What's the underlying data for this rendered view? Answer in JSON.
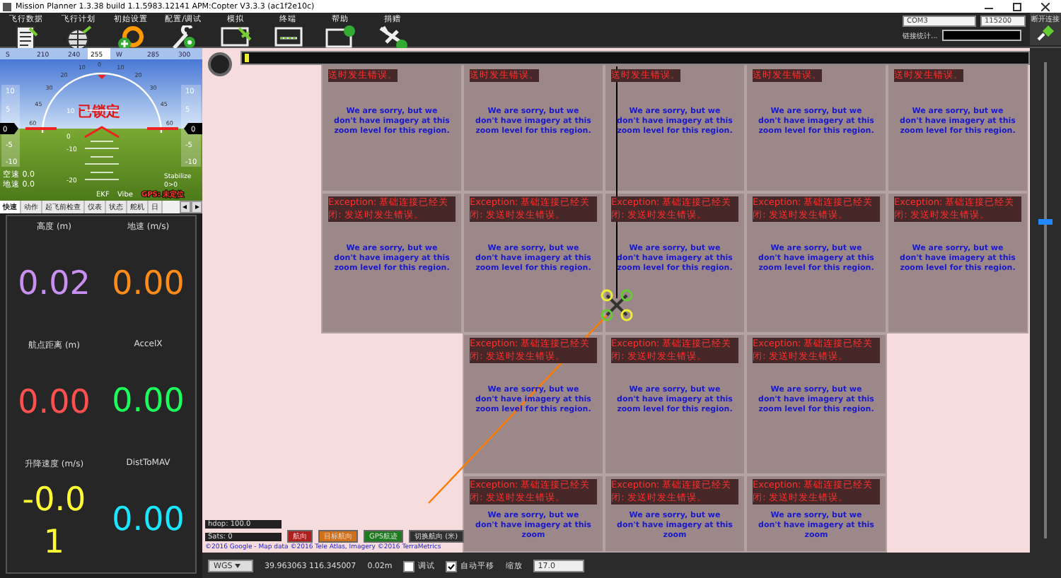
{
  "window": {
    "title": "Mission Planner 1.3.38 build 1.1.5983.12141 APM:Copter V3.3.3 (ac1f2e10c)"
  },
  "toolbar": [
    {
      "label": "飞行数据",
      "kind": "document"
    },
    {
      "label": "飞行计划",
      "kind": "globe"
    },
    {
      "label": "初始设置",
      "kind": "gear"
    },
    {
      "label": "配置/调试",
      "kind": "wrench"
    },
    {
      "label": "模拟",
      "kind": "monitor-plane"
    },
    {
      "label": "终端",
      "kind": "monitor-terminal"
    },
    {
      "label": "帮助",
      "kind": "monitor-help"
    },
    {
      "label": "捐赠",
      "kind": "plane-dollar"
    }
  ],
  "connection": {
    "port": "COM3",
    "baud": "115200",
    "stats_label": "链接统计...",
    "connect_label": "断开连接"
  },
  "hud": {
    "heading_tape": [
      "S",
      "210",
      "240",
      "W",
      "285",
      "300"
    ],
    "heading": "255",
    "roll_scale": [
      "60",
      "45",
      "30",
      "20",
      "10",
      "0",
      "10",
      "20",
      "30",
      "45",
      "60"
    ],
    "status": "已锁定",
    "pitch_labels": [
      "10",
      "0",
      "-10",
      "-20"
    ],
    "speed_tape": [
      "10",
      "5",
      "-5",
      "-10"
    ],
    "speed": "0",
    "alt_tape": [
      "10",
      "5",
      "-5",
      "-10"
    ],
    "altitude": "0",
    "airspeed": "空速 0.0",
    "groundspeed": "地速 0.0",
    "mode": "Stabilize",
    "waypoint": "0>0",
    "ekf": "EKF",
    "vibe": "Vibe",
    "gps": "GPS: 未定位"
  },
  "tabs": [
    {
      "label": "快速",
      "selected": true
    },
    {
      "label": "动作",
      "selected": false
    },
    {
      "label": "起飞前检查",
      "selected": false
    },
    {
      "label": "仪表",
      "selected": false
    },
    {
      "label": "状态",
      "selected": false
    },
    {
      "label": "舵机",
      "selected": false
    },
    {
      "label": "日",
      "selected": false
    }
  ],
  "quick_view": [
    {
      "label": "高度 (m)",
      "value": "0.02",
      "color": "#c890f0"
    },
    {
      "label": "地速 (m/s)",
      "value": "0.00",
      "color": "#ff8c1a"
    },
    {
      "label": "航点距离 (m)",
      "value": "0.00",
      "color": "#ff5050"
    },
    {
      "label": "AccelX",
      "value": "0.00",
      "color": "#1aff5a"
    },
    {
      "label": "升降速度 (m/s)",
      "value": "-0.01",
      "color": "#ffff33"
    },
    {
      "label": "DistToMAV",
      "value": "0.00",
      "color": "#1ae6ff"
    }
  ],
  "map_tiles": [
    [
      {
        "kind": "empty"
      },
      {
        "kind": "error",
        "error": "送时发生错误。",
        "message": "We are sorry, but we don't have imagery at this zoom level for this region."
      },
      {
        "kind": "error",
        "error": "送时发生错误。",
        "message": "We are sorry, but we don't have imagery at this zoom level for this region."
      },
      {
        "kind": "error",
        "error": "送时发生错误。",
        "message": "We are sorry, but we don't have imagery at this zoom level for this region."
      },
      {
        "kind": "error",
        "error": "送时发生错误。",
        "message": "We are sorry, but we don't have imagery at this zoom level for this region."
      },
      {
        "kind": "error",
        "error": "送时发生错误。",
        "message": "We are sorry, but we don't have imagery at this zoom level for this region."
      }
    ],
    [
      {
        "kind": "empty"
      },
      {
        "kind": "error",
        "error": "Exception: 基础连接已经关闭: 发送时发生错误。",
        "message": "We are sorry, but we don't have imagery at this zoom level for this region."
      },
      {
        "kind": "error",
        "error": "Exception: 基础连接已经关闭: 发送时发生错误。",
        "message": "We are sorry, but we don't have imagery at this zoom level for this region."
      },
      {
        "kind": "error",
        "error": "Exception: 基础连接已经关闭: 发送时发生错误。",
        "message": "We are sorry, but we don't have imagery at this zoom level for this region."
      },
      {
        "kind": "error",
        "error": "Exception: 基础连接已经关闭: 发送时发生错误。",
        "message": "We are sorry, but we don't have imagery at this zoom level for this region."
      },
      {
        "kind": "error",
        "error": "Exception: 基础连接已经关闭: 发送时发生错误。",
        "message": "We are sorry, but we don't have imagery at this zoom level for this region."
      }
    ],
    [
      {
        "kind": "empty"
      },
      {
        "kind": "empty"
      },
      {
        "kind": "error",
        "error": "Exception: 基础连接已经关闭: 发送时发生错误。",
        "message": "We are sorry, but we don't have imagery at this zoom level for this region."
      },
      {
        "kind": "error",
        "error": "Exception: 基础连接已经关闭: 发送时发生错误。",
        "message": "We are sorry, but we don't have imagery at this zoom level for this region."
      },
      {
        "kind": "error",
        "error": "Exception: 基础连接已经关闭: 发送时发生错误。",
        "message": "We are sorry, but we don't have imagery at this zoom level for this region."
      },
      {
        "kind": "empty"
      }
    ],
    [
      {
        "kind": "empty"
      },
      {
        "kind": "empty"
      },
      {
        "kind": "error",
        "error": "Exception: 基础连接已经关闭: 发送时发生错误。",
        "message": "We are sorry, but we don't have imagery at this zoom"
      },
      {
        "kind": "error",
        "error": "Exception: 基础连接已经关闭: 发送时发生错误。",
        "message": "We are sorry, but we don't have imagery at this zoom"
      },
      {
        "kind": "error",
        "error": "Exception: 基础连接已经关闭: 发送时发生错误。",
        "message": "We are sorry, but we don't have imagery at this zoom"
      },
      {
        "kind": "empty"
      }
    ]
  ],
  "map_status": {
    "hdop": "hdop: 100.0",
    "sats": "Sats: 0",
    "legend": [
      {
        "label": "航向",
        "color": "#b01e1e"
      },
      {
        "label": "目标航向",
        "color": "#d07018"
      },
      {
        "label": "GPS航迹",
        "color": "#1e7a1e"
      },
      {
        "label": "切换航向 (米)",
        "color": "#303030"
      }
    ],
    "copyright": "©2016 Google - Map data ©2016 Tele Atlas, Imagery ©2016 TerraMetrics"
  },
  "zoom_slider": {
    "level": 0.67
  },
  "bottom_bar": {
    "datum": "WGS",
    "coordinates": "39.963063 116.345007",
    "altitude": "0.02m",
    "debug": {
      "label": "调试",
      "checked": false
    },
    "autopan": {
      "label": "自动平移",
      "checked": true
    },
    "zoom_label": "缩放",
    "zoom_value": "17.0"
  }
}
